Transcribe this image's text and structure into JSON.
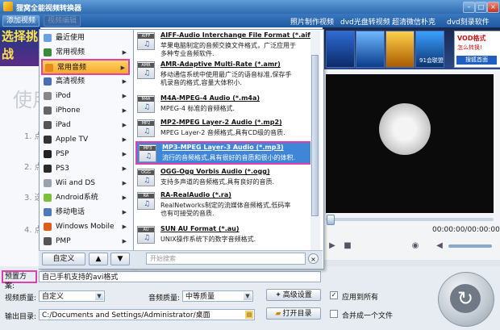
{
  "window": {
    "title": "狸窝全能视频转换器"
  },
  "toolbar": {
    "add_video": "添加视频",
    "edit_video": "视频编辑",
    "links": [
      "照片制作视频",
      "dvd光盘转视频",
      "超清微信朴克",
      "dvd刻录软件"
    ]
  },
  "banner": {
    "left_text": "选择挑战",
    "vod_label": "VOD格式",
    "vod_sub": "怎么转换!",
    "union": "91会联盟",
    "search_label": "搜狐首面"
  },
  "canvas": {
    "watermark": "使用",
    "steps": [
      "1. 点",
      "2. 点",
      "3. 选",
      "4. 点"
    ]
  },
  "menu_categories": [
    {
      "label": "最近使用",
      "color": "#6aa0e0"
    },
    {
      "label": "常用视频",
      "color": "#3c8a3c"
    },
    {
      "label": "常用音频",
      "color": "#e58a1a"
    },
    {
      "label": "高清视频",
      "color": "#4a6fb0"
    },
    {
      "label": "iPod",
      "color": "#888888"
    },
    {
      "label": "iPhone",
      "color": "#666666"
    },
    {
      "label": "iPad",
      "color": "#555555"
    },
    {
      "label": "Apple TV",
      "color": "#333333"
    },
    {
      "label": "PSP",
      "color": "#222222"
    },
    {
      "label": "PS3",
      "color": "#2a2a2a"
    },
    {
      "label": "Wii and DS",
      "color": "#9aa3ad"
    },
    {
      "label": "Android系统",
      "color": "#7cbf3a"
    },
    {
      "label": "移动电话",
      "color": "#4a7ab8"
    },
    {
      "label": "Windows Mobile",
      "color": "#e05a1a"
    },
    {
      "label": "PMP",
      "color": "#555555"
    }
  ],
  "formats": [
    {
      "badge": "AIFF",
      "name": "AIFF-Audio Interchange File Format (*.aiff)",
      "desc1": "苹果电脑制定的音频交换文件格式，广泛应用于",
      "desc2": "多种专业音频软件."
    },
    {
      "badge": "AMR",
      "name": "AMR-Adaptive Multi-Rate (*.amr)",
      "desc1": "移动通信系统中使用最广泛的语音标准,保存手",
      "desc2": "机录音的格式,容量大体积小."
    },
    {
      "badge": "M4A",
      "name": "M4A-MPEG-4 Audio (*.m4a)",
      "desc1": "MPEG-4 标准的音频格式.",
      "desc2": ""
    },
    {
      "badge": "MP2",
      "name": "MP2-MPEG Layer-2 Audio (*.mp2)",
      "desc1": "MPEG Layer-2 音频格式,具有CD级的音质.",
      "desc2": ""
    },
    {
      "badge": "MP3",
      "name": "MP3-MPEG Layer-3 Audio (*.mp3)",
      "desc1": "流行的音频格式,具有很好的音质和很小的体积.",
      "desc2": ""
    },
    {
      "badge": "OGG",
      "name": "OGG-Ogg Vorbis Audio (*.ogg)",
      "desc1": "支持多声道的音频格式,具有良好的音质.",
      "desc2": ""
    },
    {
      "badge": "RA",
      "name": "RA-RealAudio (*.ra)",
      "desc1": "RealNetworks制定的流媒体音频格式,低码率",
      "desc2": "也有可接受的音质."
    },
    {
      "badge": "AU",
      "name": "SUN AU Format (*.au)",
      "desc1": "UNIX操作系统下的数字音频格式.",
      "desc2": ""
    }
  ],
  "menu_footer": {
    "custom": "自定义",
    "search_placeholder": "开始搜索"
  },
  "player": {
    "timecode": "00:00:00/00:00:00"
  },
  "preset": {
    "label": "预置方案:",
    "value": "自己手机支持的avi格式"
  },
  "video_quality": {
    "label": "视频质量:",
    "value": "自定义"
  },
  "audio_quality": {
    "label": "音频质量:",
    "value": "中等质量"
  },
  "advanced": "高级设置",
  "apply_all": "应用到所有",
  "output": {
    "label": "输出目录:",
    "path": "C:/Documents and Settings/Administrator/桌面"
  },
  "open_dir": "打开目录",
  "merge": "合并成一个文件"
}
